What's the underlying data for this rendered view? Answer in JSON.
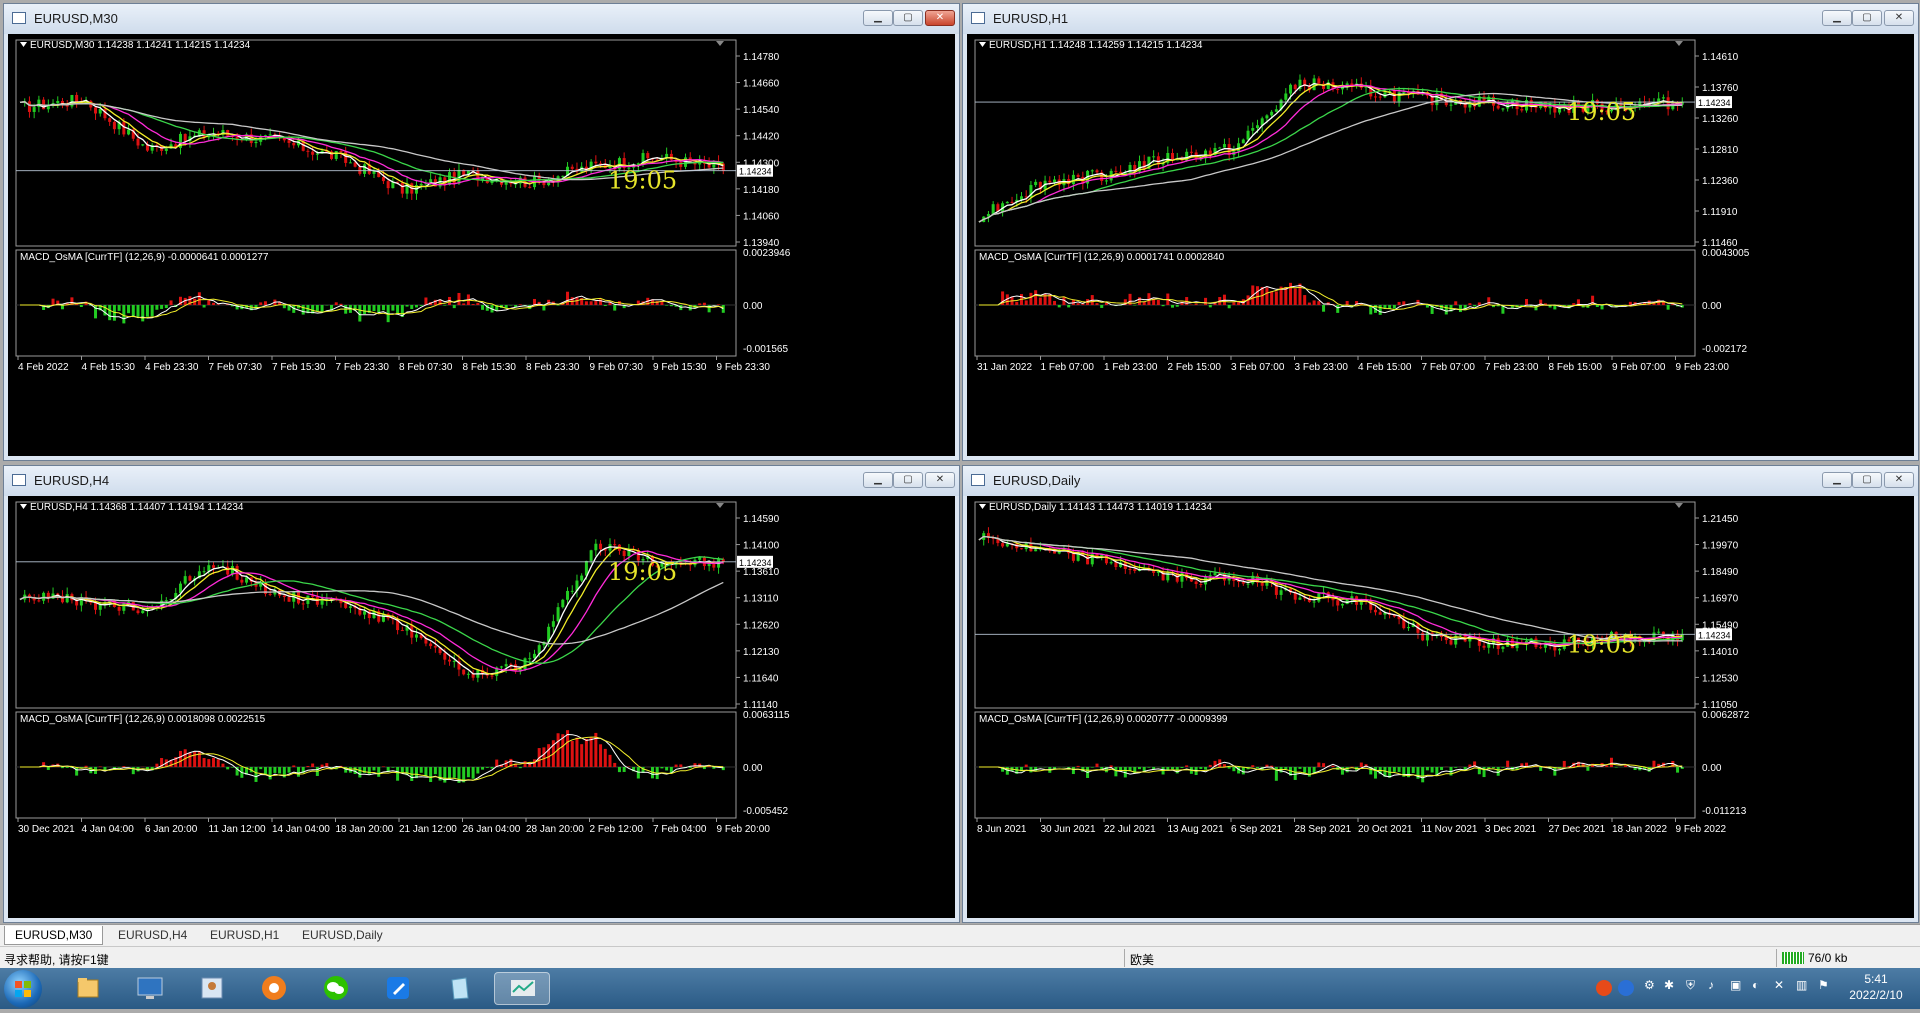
{
  "windows": [
    {
      "title": "EURUSD,M30",
      "info": "EURUSD,M30  1.14238 1.14241 1.14215 1.14234",
      "price_ticks": [
        "1.14780",
        "1.14660",
        "1.14540",
        "1.14420",
        "1.14300",
        "1.14180",
        "1.14060",
        "1.13940"
      ],
      "current_price": "1.14234",
      "macd_label": "MACD_OsMA [CurrTF] (12,26,9) -0.0000641 0.0001277",
      "macd_ticks": [
        "0.0023946",
        "0.00",
        "-0.001565"
      ],
      "time_labels": [
        "4 Feb 2022",
        "4 Feb 15:30",
        "4 Feb 23:30",
        "7 Feb 07:30",
        "7 Feb 15:30",
        "7 Feb 23:30",
        "8 Feb 07:30",
        "8 Feb 15:30",
        "8 Feb 23:30",
        "9 Feb 07:30",
        "9 Feb 15:30",
        "9 Feb 23:30"
      ],
      "clock": "19:05"
    },
    {
      "title": "EURUSD,H1",
      "info": "EURUSD,H1  1.14248 1.14259 1.14215 1.14234",
      "price_ticks": [
        "1.14610",
        "1.13760",
        "1.13260",
        "1.12810",
        "1.12360",
        "1.11910",
        "1.11460"
      ],
      "current_price": "1.14234",
      "macd_label": "MACD_OsMA [CurrTF] (12,26,9) 0.0001741 0.0002840",
      "macd_ticks": [
        "0.0043005",
        "0.00",
        "-0.002172"
      ],
      "time_labels": [
        "31 Jan 2022",
        "1 Feb 07:00",
        "1 Feb 23:00",
        "2 Feb 15:00",
        "3 Feb 07:00",
        "3 Feb 23:00",
        "4 Feb 15:00",
        "7 Feb 07:00",
        "7 Feb 23:00",
        "8 Feb 15:00",
        "9 Feb 07:00",
        "9 Feb 23:00"
      ],
      "clock": "19:05"
    },
    {
      "title": "EURUSD,H4",
      "info": "EURUSD,H4  1.14368 1.14407 1.14194 1.14234",
      "price_ticks": [
        "1.14590",
        "1.14100",
        "1.13610",
        "1.13110",
        "1.12620",
        "1.12130",
        "1.11640",
        "1.11140"
      ],
      "current_price": "1.14234",
      "macd_label": "MACD_OsMA [CurrTF] (12,26,9) 0.0018098 0.0022515",
      "macd_ticks": [
        "0.0063115",
        "0.00",
        "-0.005452"
      ],
      "time_labels": [
        "30 Dec 2021",
        "4 Jan 04:00",
        "6 Jan 20:00",
        "11 Jan 12:00",
        "14 Jan 04:00",
        "18 Jan 20:00",
        "21 Jan 12:00",
        "26 Jan 04:00",
        "28 Jan 20:00",
        "2 Feb 12:00",
        "7 Feb 04:00",
        "9 Feb 20:00"
      ],
      "clock": "19:05"
    },
    {
      "title": "EURUSD,Daily",
      "info": "EURUSD,Daily  1.14143 1.14473 1.14019 1.14234",
      "price_ticks": [
        "1.21450",
        "1.19970",
        "1.18490",
        "1.16970",
        "1.15490",
        "1.14010",
        "1.12530",
        "1.11050"
      ],
      "current_price": "1.14234",
      "macd_label": "MACD_OsMA [CurrTF] (12,26,9) 0.0020777 -0.0009399",
      "macd_ticks": [
        "0.0062872",
        "0.00",
        "-0.011213"
      ],
      "time_labels": [
        "8 Jun 2021",
        "30 Jun 2021",
        "22 Jul 2021",
        "13 Aug 2021",
        "6 Sep 2021",
        "28 Sep 2021",
        "20 Oct 2021",
        "11 Nov 2021",
        "3 Dec 2021",
        "27 Dec 2021",
        "18 Jan 2022",
        "9 Feb 2022"
      ],
      "clock": "19:05"
    }
  ],
  "tabs": [
    "EURUSD,M30",
    "EURUSD,H4",
    "EURUSD,H1",
    "EURUSD,Daily"
  ],
  "status": {
    "help": "寻求帮助, 请按F1键",
    "profile": "欧美",
    "traffic": "76/0 kb"
  },
  "clock": {
    "time": "5:41",
    "date": "2022/2/10"
  },
  "colors": {
    "bull": "#22cc22",
    "bear": "#dd1111",
    "white_ma": "#ffffff",
    "yellow_ma": "#f2ee2a",
    "magenta_ma": "#ff2bd9",
    "green_ma": "#3bd64a",
    "gray_ma": "#c8c8c8",
    "clock_text": "#e7e52a"
  }
}
